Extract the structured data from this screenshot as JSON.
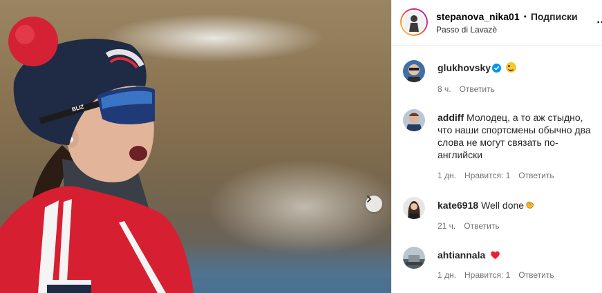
{
  "post": {
    "author": "stepanova_nika01",
    "separator": "•",
    "follow_label": "Подписки",
    "location": "Passo di Lavazè",
    "more_label": "⋯",
    "photo_brand_text": "BLIZ",
    "next_icon": "chevron-right-icon"
  },
  "comments": [
    {
      "username": "glukhovsky",
      "text": "",
      "verified": true,
      "emoji": "smile-emoji",
      "time": "8 ч.",
      "likes": "",
      "reply": "Ответить"
    },
    {
      "username": "addiff",
      "text": "Молодец, а то аж стыдно, что наши спортсмены обычно два слова не могут связать по-английски",
      "verified": false,
      "emoji": "",
      "time": "1 дн.",
      "likes": "Нравится: 1",
      "reply": "Ответить"
    },
    {
      "username": "kate6918",
      "text": "Well done",
      "verified": false,
      "emoji": "clap-emoji",
      "time": "21 ч.",
      "likes": "",
      "reply": "Ответить"
    },
    {
      "username": "ahtiannala",
      "text": "",
      "verified": false,
      "emoji": "heart-emoji",
      "time": "1 дн.",
      "likes": "Нравится: 1",
      "reply": "Ответить"
    }
  ],
  "colors": {
    "verified": "#0095f6",
    "heart": "#ed1f38",
    "muted_text": "#737373",
    "border": "#efefef"
  }
}
